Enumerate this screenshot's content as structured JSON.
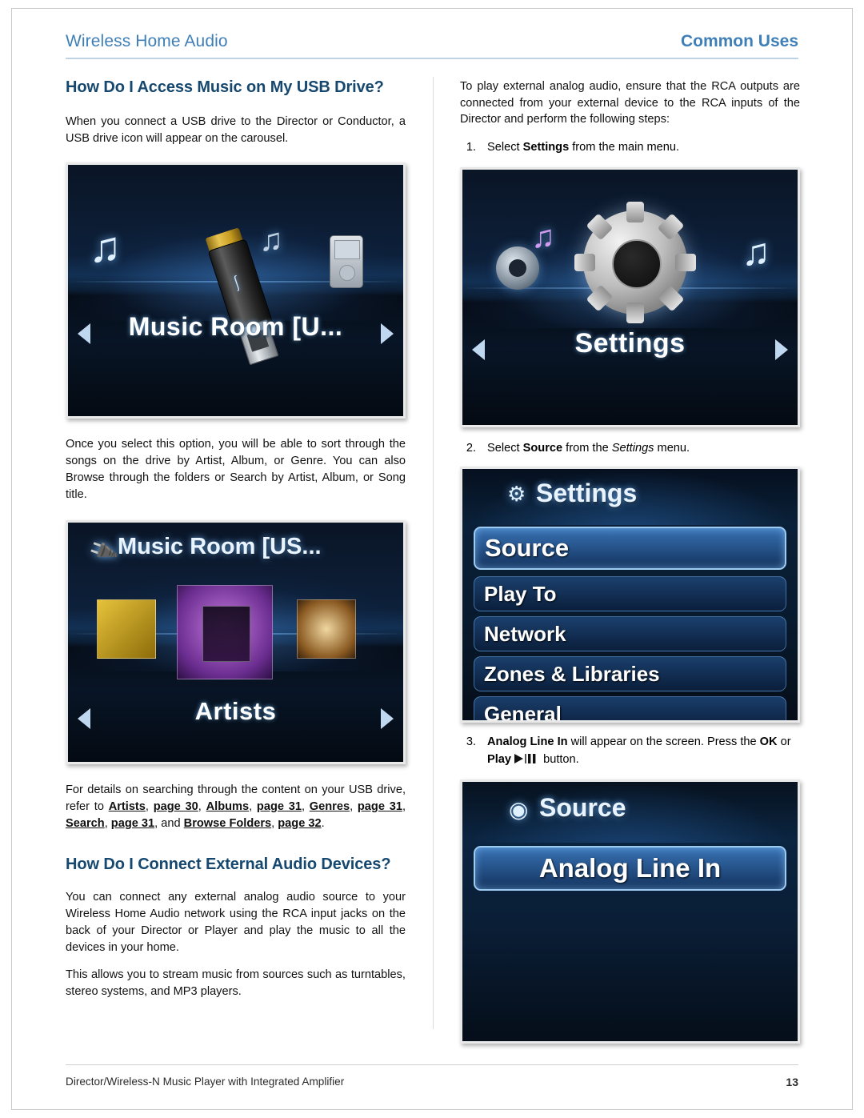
{
  "header": {
    "left_title": "Wireless Home Audio",
    "right_title": "Common Uses"
  },
  "left_column": {
    "heading": "How Do I Access Music on My USB Drive?",
    "para1": "When you connect a USB drive to the Director or Conductor, a USB drive icon will appear on the carousel.",
    "para2": "Once you select this option, you will be able to sort through the songs on the drive by Artist, Album, or Genre. You can also Browse through the folders or Search by Artist, Album, or  Song title.",
    "para3_prefix": "For details on searching through the content on your USB drive, refer to ",
    "para3_links": [
      "Artists",
      ", ",
      "page 30",
      ", ",
      "Albums",
      ", ",
      "page 31",
      ", ",
      "Genres",
      ", ",
      "page 31",
      ", ",
      "Search",
      ", ",
      "page 31",
      ", and ",
      "Browse Folders",
      ", ",
      "page 32",
      "."
    ],
    "heading2": "How Do I Connect External Audio Devices?",
    "para4": "You can connect any external analog audio source to your Wireless Home Audio network using the RCA input jacks on the back of your Director or Player and play the music to all the devices in your home.",
    "para5": "This allows you to stream music from sources such as turntables, stereo systems, and MP3 players.",
    "screenshot1": {
      "label": "Music Room [U...",
      "left_arrow": "previous-arrow",
      "right_arrow": "next-arrow"
    },
    "screenshot2": {
      "title": "Music Room [US...",
      "label": "Artists",
      "left_arrow": "previous-arrow",
      "right_arrow": "next-arrow"
    }
  },
  "right_column": {
    "intro": "To play external analog audio, ensure that the RCA outputs are connected from your external device to the RCA inputs of the Director and perform the following steps:",
    "steps": [
      {
        "num": "1.",
        "text_before": "Select ",
        "bold": "Settings",
        "text_after": " from the main menu."
      },
      {
        "num": "2.",
        "text_before": "Select ",
        "bold": "Source",
        "text_after_italic": "Settings",
        "text_after": " from the ",
        "text_end": " menu."
      },
      {
        "num": "3.",
        "bold_lead": "Analog Line In",
        "text_mid": " will appear on the screen. Press the ",
        "bold_ok": "OK",
        "text_next": " or ",
        "bold_play": "Play",
        "text_end": " button."
      }
    ],
    "screenshot_settings_carousel": {
      "label": "Settings",
      "left_arrow": "previous-arrow",
      "right_arrow": "next-arrow"
    },
    "screenshot_settings_menu": {
      "title": "Settings",
      "items": [
        "Source",
        "Play To",
        "Network",
        "Zones & Libraries",
        "General"
      ],
      "selected": "Source"
    },
    "screenshot_source_menu": {
      "title": "Source",
      "items": [
        "Analog Line In"
      ],
      "selected": "Analog Line In"
    }
  },
  "footer": {
    "left": "Director/Wireless-N Music Player with Integrated Amplifier",
    "page_number": "13"
  },
  "colors": {
    "header_blue": "#3f7fb8",
    "heading_blue": "#16486f",
    "rule_blue": "#bfd3e4"
  }
}
